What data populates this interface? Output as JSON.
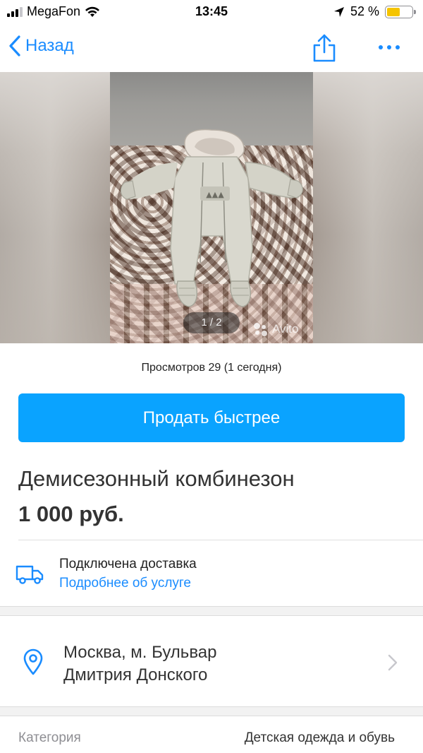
{
  "status_bar": {
    "carrier": "MegaFon",
    "time": "13:45",
    "battery_percent": "52 %",
    "battery_level": 0.52,
    "signal_bars": 3,
    "signal_bars_total": 4,
    "icons": [
      "signal-icon",
      "wifi-icon",
      "location-arrow-icon",
      "battery-icon"
    ]
  },
  "nav": {
    "back_label": "Назад",
    "icons": [
      "chevron-left-icon",
      "share-icon",
      "more-dots-icon"
    ]
  },
  "gallery": {
    "counter": "1 / 2",
    "watermark": "Avito"
  },
  "listing": {
    "views": "Просмотров 29 (1 сегодня)",
    "sell_button": "Продать быстрее",
    "title": "Демисезонный комбинезон",
    "price": "1 000 руб."
  },
  "delivery": {
    "title": "Подключена доставка",
    "link": "Подробнее об услуге",
    "icon": "truck-icon"
  },
  "location": {
    "line1": "Москва, м. Бульвар",
    "line2": "Дмитрия Донского",
    "icon": "location-pin-icon"
  },
  "details": {
    "category_label": "Категория",
    "category_value": "Детская одежда и обувь"
  },
  "colors": {
    "accent_blue": "#1a8cff",
    "button_blue": "#0aa3ff",
    "battery_yellow": "#f5c400"
  }
}
